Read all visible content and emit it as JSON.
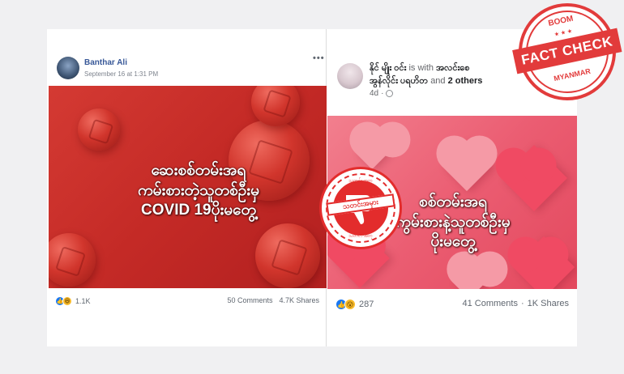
{
  "colors": {
    "facebook_blue": "#385898",
    "left_image_bg": "#c42a26",
    "right_image_bg": "#eb5d72",
    "stamp_red": "#e32c2c",
    "badge_red": "#e23b3b"
  },
  "left_post": {
    "author": "Banthar Ali",
    "date": "September 16 at 1:31 PM",
    "more_icon": "ellipsis-icon",
    "caption_line1": "ဆေးစစ်တမ်းအရ",
    "caption_line2": "ကမ်းစားတဲ့သူတစ်ဦးမှ",
    "caption_line3": "COVID 19ပိုးမတွေ့",
    "reactions": "1.1K",
    "comments": "50 Comments",
    "shares": "4.7K Shares"
  },
  "right_post": {
    "author": "နိုင် မျိုး ဝင်း",
    "with_text": "is with",
    "tagged": "အလင်းစေ",
    "tagged_line2": "အွန်လိုင်း ပရဟိတ",
    "and_text": "and",
    "others": "2 others",
    "time": "4d",
    "caption_line1": "စစ်တမ်းအရ",
    "caption_line2": "ကွမ်းစားနဲ့သူတစ်ဦးမှ",
    "caption_line3": "ပိုးမတွေ့",
    "reactions": "287",
    "comments": "41 Comments",
    "shares": "1K Shares"
  },
  "center_stamp": {
    "label": "သတင်းအမှား",
    "top_text": "သတင်း အတု",
    "bottom_text": "သတင်း အတု"
  },
  "badge": {
    "top": "BOOM",
    "label": "FACT CHECK",
    "bottom": "MYANMAR"
  }
}
